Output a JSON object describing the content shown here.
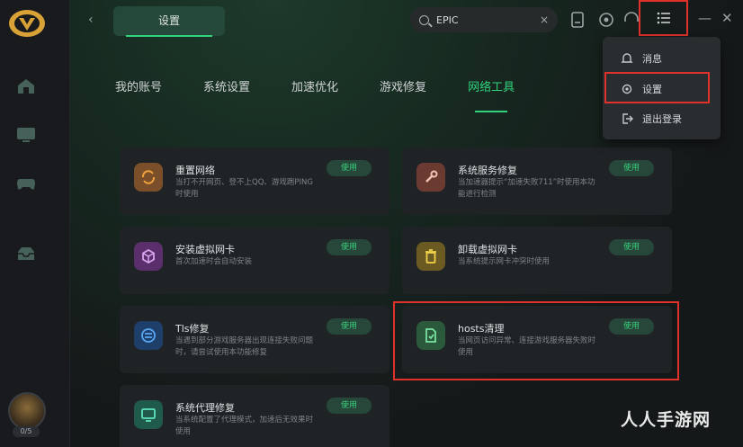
{
  "header": {
    "back_symbol": "‹",
    "settings_tab": "设置",
    "search_value": "EPIC",
    "search_clear": "×"
  },
  "nav": {
    "tabs": [
      {
        "label": "我的账号"
      },
      {
        "label": "系统设置"
      },
      {
        "label": "加速优化"
      },
      {
        "label": "游戏修复"
      },
      {
        "label": "网络工具",
        "active": true
      }
    ]
  },
  "cards": [
    {
      "title": "重置网络",
      "desc": "当打不开网页、登不上QQ、游戏跑PING时使用",
      "action": "使用",
      "icon": "refresh-icon",
      "color": "#7a4f2a"
    },
    {
      "title": "系统服务修复",
      "desc": "当加速器提示“加速失败711”时使用本功能进行检测",
      "action": "使用",
      "icon": "wrench-icon",
      "color": "#6b3b32"
    },
    {
      "title": "安装虚拟网卡",
      "desc": "首次加速时会自动安装",
      "action": "使用",
      "icon": "cube-icon",
      "color": "#5a2f6b"
    },
    {
      "title": "卸载虚拟网卡",
      "desc": "当系统提示网卡冲突时使用",
      "action": "使用",
      "icon": "trash-icon",
      "color": "#6b5a22"
    },
    {
      "title": "Tls修复",
      "desc": "当遇到部分游戏服务器出现连接失败问题时，请尝试使用本功能修复",
      "action": "使用",
      "icon": "tls-icon",
      "color": "#1f3f6b"
    },
    {
      "title": "hosts清理",
      "desc": "当网页访问异常、连接游戏服务器失败时使用",
      "action": "使用",
      "icon": "file-check-icon",
      "color": "#2a5a3b"
    },
    {
      "title": "系统代理修复",
      "desc": "当系统配置了代理模式，加速后无效果时使用",
      "action": "使用",
      "icon": "monitor-icon",
      "color": "#1f5a4a"
    }
  ],
  "dropdown": {
    "items": [
      {
        "label": "消息",
        "icon": "bell-icon"
      },
      {
        "label": "设置",
        "icon": "gear-icon"
      },
      {
        "label": "退出登录",
        "icon": "logout-icon"
      }
    ]
  },
  "avatar_badge": "0/5",
  "watermark": "人人手游网",
  "colors": {
    "accent": "#31d27c",
    "highlight": "#e0322b"
  }
}
